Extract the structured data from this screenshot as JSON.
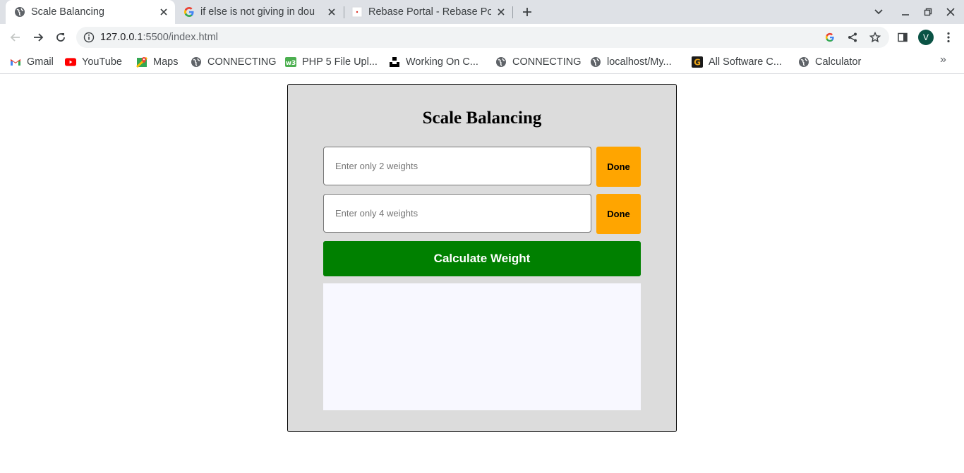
{
  "browser": {
    "tabs": [
      {
        "title": "Scale Balancing",
        "icon": "globe-icon",
        "active": true
      },
      {
        "title": "if else is not giving in dou",
        "icon": "google-icon",
        "active": false
      },
      {
        "title": "Rebase Portal - Rebase Po",
        "icon": "page-icon",
        "active": false
      }
    ],
    "address": {
      "host": "127.0.0.1",
      "rest": ":5500/index.html"
    },
    "profile_initial": "V",
    "bookmarks": [
      {
        "label": "Gmail",
        "icon": "gmail-icon"
      },
      {
        "label": "YouTube",
        "icon": "youtube-icon"
      },
      {
        "label": "Maps",
        "icon": "maps-icon"
      },
      {
        "label": "CONNECTING",
        "icon": "globe-icon"
      },
      {
        "label": "PHP 5 File Upl...",
        "icon": "w3-icon"
      },
      {
        "label": "Working On C...",
        "icon": "unsplash-icon"
      },
      {
        "label": "CONNECTING",
        "icon": "globe-icon"
      },
      {
        "label": "localhost/My...",
        "icon": "globe-icon"
      },
      {
        "label": "All Software C...",
        "icon": "g-logo-icon"
      },
      {
        "label": "Calculator",
        "icon": "globe-icon"
      }
    ],
    "bookmarks_more": "»"
  },
  "page": {
    "heading": "Scale Balancing",
    "input1": {
      "placeholder": "Enter only 2 weights",
      "value": ""
    },
    "input2": {
      "placeholder": "Enter only 4 weights",
      "value": ""
    },
    "done_label": "Done",
    "calculate_label": "Calculate Weight",
    "result_text": "",
    "colors": {
      "card_bg": "#dcdcdc",
      "done": "#ffa500",
      "calculate": "#008000",
      "result_bg": "#f8f8ff"
    }
  }
}
